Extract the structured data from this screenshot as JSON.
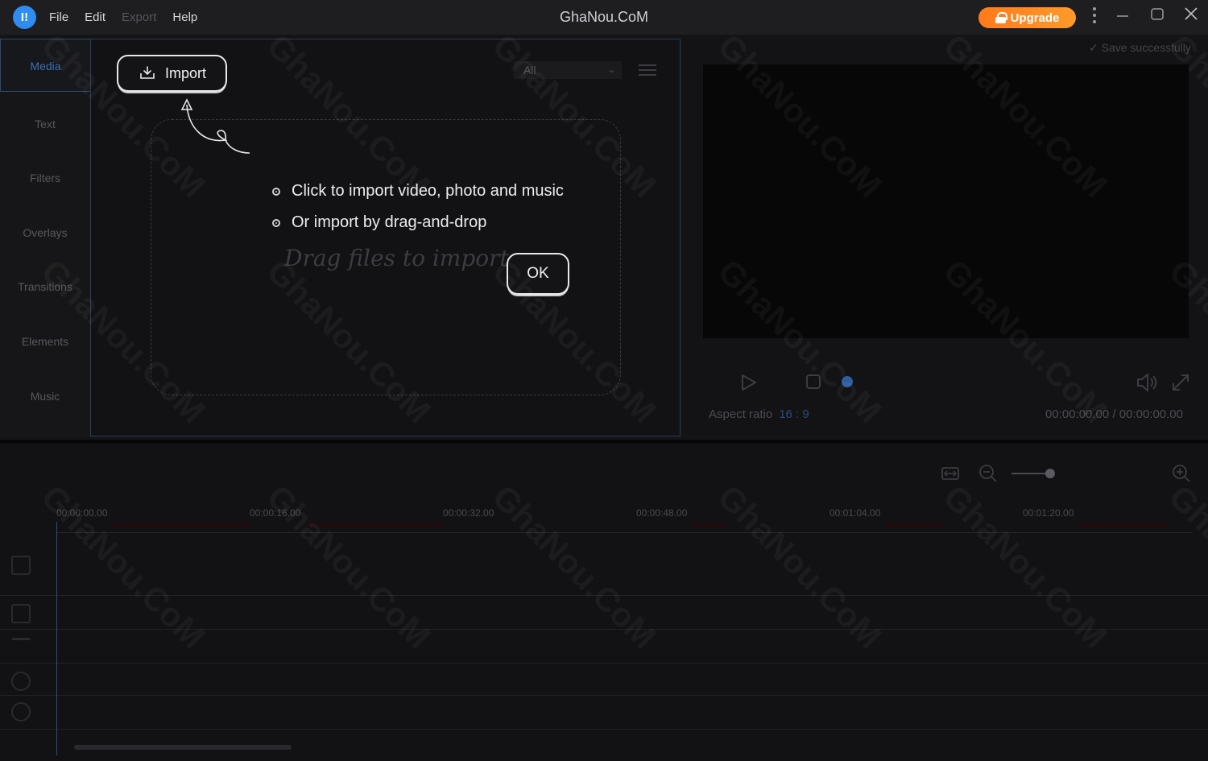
{
  "titlebar": {
    "logo_glyph": "I!",
    "menu": [
      "File",
      "Edit",
      "Export",
      "Help"
    ],
    "disabled_menu": "Export",
    "app_title": "GhaNou.CoM",
    "upgrade_label": "Upgrade",
    "accent_orange": "#ff8a22"
  },
  "sidebar": {
    "items": [
      {
        "label": "Media"
      },
      {
        "label": "Text"
      },
      {
        "label": "Filters"
      },
      {
        "label": "Overlays"
      },
      {
        "label": "Transitions"
      },
      {
        "label": "Elements"
      },
      {
        "label": "Music"
      }
    ]
  },
  "media": {
    "filter_value": "All",
    "import_label": "Import",
    "hint1": "Click to import video, photo and music",
    "hint2": "Or import by drag-and-drop",
    "drag_text": "Drag files to import",
    "ok_label": "OK"
  },
  "preview": {
    "save_status": "Save successfully",
    "aspect_label": "Aspect ratio",
    "aspect_value": "16 : 9",
    "timecode": "00:00:00.00 / 00:00:00.00",
    "accent_blue": "#2f8cf0"
  },
  "timeline": {
    "ticks": [
      "00:00:00.00",
      "00:00:16.00",
      "00:00:32.00",
      "00:00:48.00",
      "00:01:04.00",
      "00:01:20.00"
    ]
  },
  "watermark": "GhaNou.CoM"
}
